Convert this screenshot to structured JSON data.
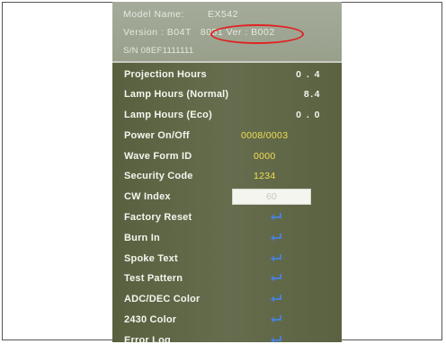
{
  "info": {
    "model_label": "Model Name:",
    "model_value": "EX542",
    "version_label": "Version : B04T",
    "version_value": "8051 Ver : B002",
    "serial": "S/N 08EF1111111"
  },
  "menu": [
    {
      "label": "Projection Hours",
      "value": "0 . 4",
      "kind": "white"
    },
    {
      "label": "Lamp Hours (Normal)",
      "value": "8.4",
      "kind": "white"
    },
    {
      "label": "Lamp Hours (Eco)",
      "value": "0 . 0",
      "kind": "white"
    },
    {
      "label": "Power On/Off",
      "value": "0008/0003",
      "kind": "yellow"
    },
    {
      "label": "Wave Form ID",
      "value": "0000",
      "kind": "yellow"
    },
    {
      "label": "Security Code",
      "value": "1234",
      "kind": "yellow"
    },
    {
      "label": "CW Index",
      "value": "60",
      "kind": "box"
    },
    {
      "label": "Factory Reset",
      "kind": "enter"
    },
    {
      "label": "Burn In",
      "kind": "enter"
    },
    {
      "label": "Spoke Text",
      "kind": "enter"
    },
    {
      "label": "Test Pattern",
      "kind": "enter"
    },
    {
      "label": "ADC/DEC Color",
      "kind": "enter"
    },
    {
      "label": "2430 Color",
      "kind": "enter"
    },
    {
      "label": "Error Log",
      "kind": "enter"
    }
  ],
  "icons": {
    "enter": "enter-return-icon"
  },
  "colors": {
    "menu_background": "#5b6347",
    "info_background": "#a0a794",
    "value_yellow": "#f4df51",
    "enter_icon_blue": "#4a7fd4",
    "highlight_ring": "#e22121"
  }
}
